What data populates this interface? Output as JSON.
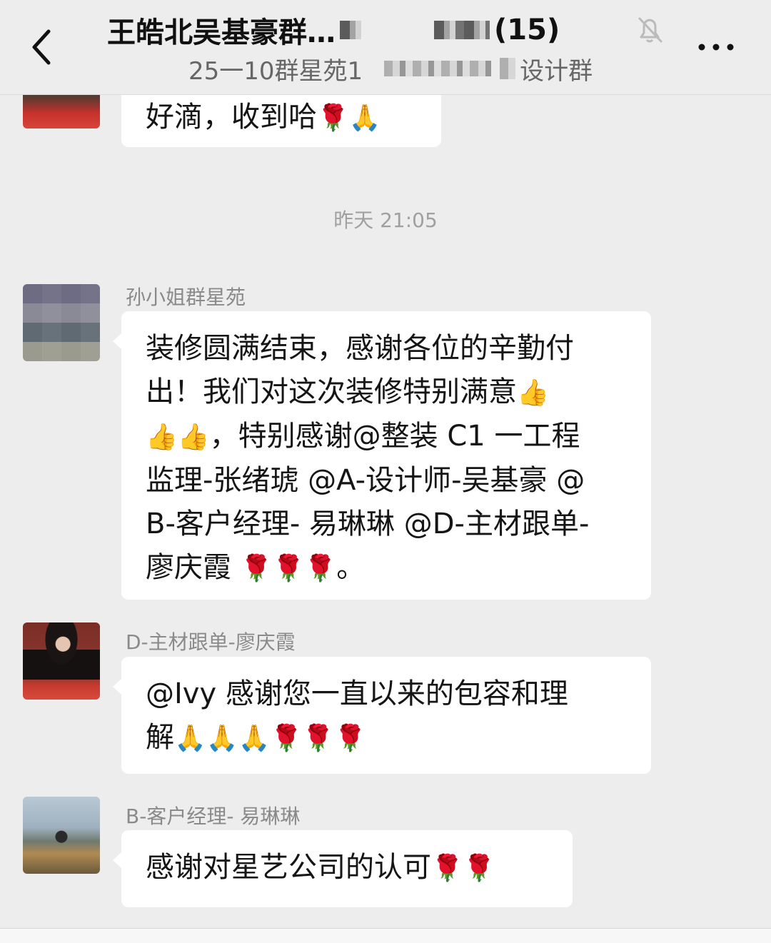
{
  "header": {
    "title": "王皓北吴基豪群…",
    "member_count": "(15)",
    "subtitle_start": "25一10群星苑1",
    "subtitle_end": "设计群",
    "back_icon": "chevron-left-icon",
    "mute_icon": "bell-off-icon",
    "more_icon": "more-dots-icon"
  },
  "messages": [
    {
      "text": "好滴，收到哈",
      "emojis": [
        "🌹",
        "🙏"
      ]
    },
    {
      "time": "昨天 21:05"
    },
    {
      "sender": "孙小姐群星苑",
      "lines": [
        "装修圆满结束，感谢各位的辛勤付",
        "出！我们对这次装修特别满意",
        "，特别感谢@整装 C1 一工程",
        "监理-张绪琥 @A-设计师-吴基豪 @",
        "B-客户经理- 易琳琳 @D-主材跟单-",
        "廖庆霞 ",
        "。"
      ],
      "emojis": [
        "👍",
        "👍",
        "👍",
        "🌹",
        "🌹",
        "🌹"
      ]
    },
    {
      "sender": "D-主材跟单-廖庆霞",
      "lines": [
        "@Ivy 感谢您一直以来的包容和理",
        "解"
      ],
      "emojis": [
        "🙏",
        "🙏",
        "🙏",
        "🌹",
        "🌹",
        "🌹"
      ]
    },
    {
      "sender": "B-客户经理- 易琳琳",
      "text": "感谢对星艺公司的认可",
      "emojis": [
        "🌹",
        "🌹"
      ]
    }
  ]
}
